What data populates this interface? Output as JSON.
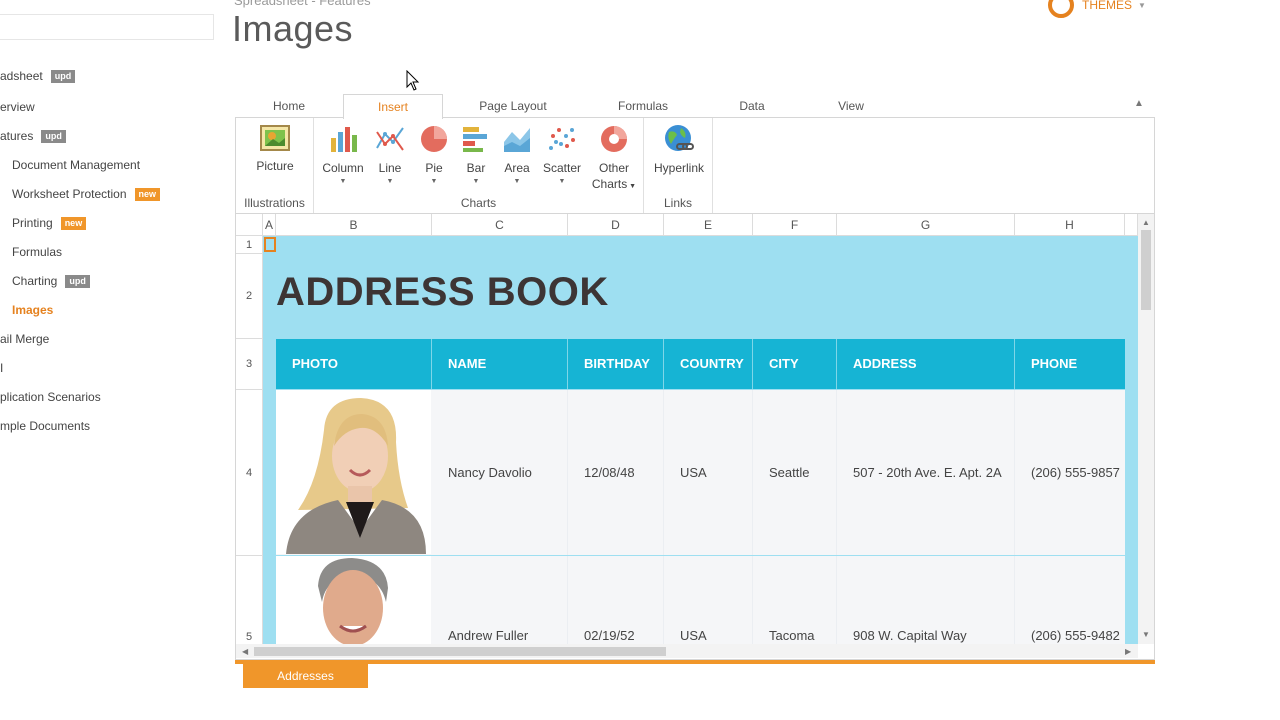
{
  "sidebar": {
    "items": [
      {
        "label": "adsheet",
        "badge": "upd",
        "level": "top"
      },
      {
        "label": "erview",
        "badge": "",
        "level": "top"
      },
      {
        "label": "atures",
        "badge": "upd",
        "level": "top"
      },
      {
        "label": "Document Management",
        "badge": "",
        "level": "sub"
      },
      {
        "label": "Worksheet Protection",
        "badge": "new",
        "level": "sub"
      },
      {
        "label": "Printing",
        "badge": "new",
        "level": "sub"
      },
      {
        "label": "Formulas",
        "badge": "",
        "level": "sub"
      },
      {
        "label": "Charting",
        "badge": "upd",
        "level": "sub"
      },
      {
        "label": "Images",
        "badge": "",
        "level": "sub",
        "active": true
      },
      {
        "label": "ail Merge",
        "badge": "",
        "level": "top"
      },
      {
        "label": "I",
        "badge": "",
        "level": "top"
      },
      {
        "label": "plication Scenarios",
        "badge": "",
        "level": "top"
      },
      {
        "label": "mple Documents",
        "badge": "",
        "level": "top"
      }
    ]
  },
  "header": {
    "breadcrumb": "Spreadsheet - Features",
    "title": "Images",
    "themes_label": "THEMES"
  },
  "ribbon": {
    "tabs": [
      "Home",
      "Insert",
      "Page Layout",
      "Formulas",
      "Data",
      "View"
    ],
    "active_tab": "Insert",
    "groups": {
      "illustrations": {
        "label": "Illustrations",
        "picture": "Picture"
      },
      "charts": {
        "label": "Charts",
        "column": "Column",
        "line": "Line",
        "pie": "Pie",
        "bar": "Bar",
        "area": "Area",
        "scatter": "Scatter",
        "other_1": "Other",
        "other_2": "Charts"
      },
      "links": {
        "label": "Links",
        "hyperlink": "Hyperlink"
      }
    }
  },
  "grid": {
    "columns": [
      "A",
      "B",
      "C",
      "D",
      "E",
      "F",
      "G",
      "H"
    ],
    "rows": [
      "1",
      "2",
      "3",
      "4",
      "5"
    ],
    "book_title": "ADDRESS BOOK",
    "headers": [
      "PHOTO",
      "NAME",
      "BIRTHDAY",
      "COUNTRY",
      "CITY",
      "ADDRESS",
      "PHONE"
    ],
    "records": [
      {
        "name": "Nancy Davolio",
        "birthday": "12/08/48",
        "country": "USA",
        "city": "Seattle",
        "address": "507 - 20th Ave. E. Apt. 2A",
        "phone": "(206) 555-9857"
      },
      {
        "name": "Andrew Fuller",
        "birthday": "02/19/52",
        "country": "USA",
        "city": "Tacoma",
        "address": "908 W. Capital Way",
        "phone": "(206) 555-9482"
      }
    ]
  },
  "sheet_tabs": [
    "Addresses"
  ],
  "colors": {
    "accent": "#e5821f",
    "header_fill": "#16b4d4",
    "sheet_fill": "#9edff1"
  }
}
